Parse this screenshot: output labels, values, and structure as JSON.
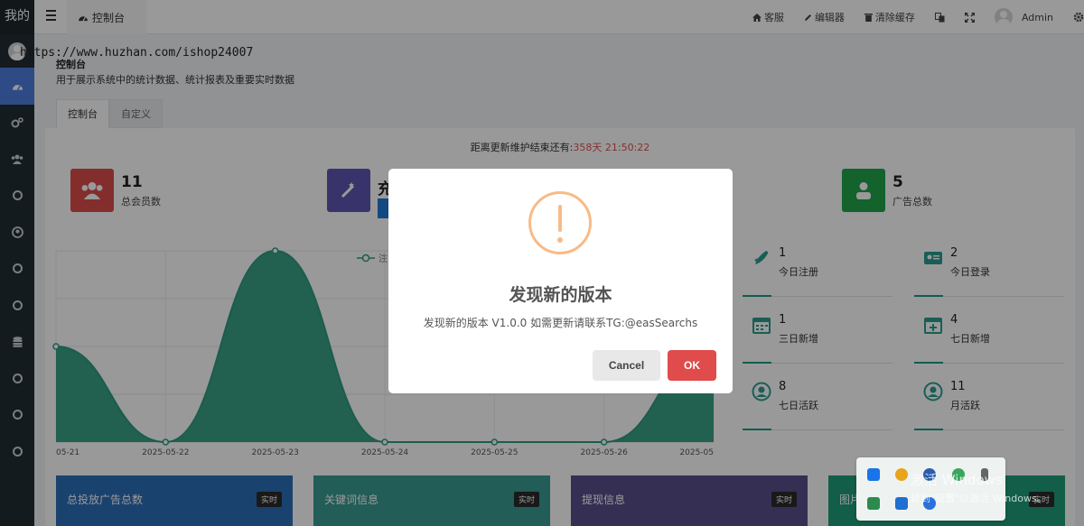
{
  "sidebar": {
    "brand": "我的",
    "items": [
      {
        "icon": "dashboard-icon",
        "active": true
      },
      {
        "icon": "cogs-icon"
      },
      {
        "icon": "users-icon"
      },
      {
        "icon": "circle-icon"
      },
      {
        "icon": "user-circle-icon"
      },
      {
        "icon": "circle-icon"
      },
      {
        "icon": "circle-icon"
      },
      {
        "icon": "database-icon"
      },
      {
        "icon": "circle-icon"
      },
      {
        "icon": "circle-icon"
      },
      {
        "icon": "circle-icon"
      }
    ]
  },
  "topbar": {
    "tab_label": "控制台",
    "kefu": "客服",
    "editor": "编辑器",
    "clear_cache": "清除缓存",
    "admin": "Admin"
  },
  "watermark_url": "https://www.huzhan.com/ishop24007",
  "page": {
    "title": "控制台",
    "description": "用于展示系统中的统计数据、统计报表及重要实时数据",
    "tabs": [
      "控制台",
      "自定义"
    ]
  },
  "maintenance": {
    "label": "距离更新维护结束还有:",
    "value": "358天 21:50:22"
  },
  "stats": [
    {
      "value": "11",
      "label": "总会员数",
      "color": "#dd4b4b"
    },
    {
      "value": "充",
      "label": "",
      "color": "#5e58b3"
    },
    {
      "value": "5",
      "label": "广告总数",
      "color": "#22a34a"
    }
  ],
  "mini_stats": [
    {
      "value": "1",
      "label": "今日注册",
      "icon": "rocket-icon"
    },
    {
      "value": "2",
      "label": "今日登录",
      "icon": "id-card-icon"
    },
    {
      "value": "1",
      "label": "三日新增",
      "icon": "calendar-icon"
    },
    {
      "value": "4",
      "label": "七日新增",
      "icon": "calendar-plus-icon"
    },
    {
      "value": "8",
      "label": "七日活跃",
      "icon": "user-circle-icon"
    },
    {
      "value": "11",
      "label": "月活跃",
      "icon": "user-circle-icon"
    }
  ],
  "chart_data": {
    "type": "area",
    "x": [
      "05-21",
      "2025-05-22",
      "2025-05-23",
      "2025-05-24",
      "2025-05-25",
      "2025-05-26",
      "2025-05"
    ],
    "series": [
      {
        "name": "注",
        "values": [
          1,
          0,
          2,
          0,
          0,
          0,
          1
        ]
      }
    ],
    "ylim": [
      0,
      2
    ],
    "grid": true,
    "color": "#2e9b80"
  },
  "cards": [
    {
      "title": "总投放广告总数",
      "badge": "实时",
      "color": "#2c6fb8"
    },
    {
      "title": "关键词信息",
      "badge": "实时",
      "color": "#3a9c93"
    },
    {
      "title": "提现信息",
      "badge": "实时",
      "color": "#5a4f8c"
    },
    {
      "title": "图片",
      "badge": "实时",
      "color": "#1f9d78"
    }
  ],
  "modal": {
    "title": "发现新的版本",
    "text": "发现新的版本 V1.0.0 如需更新请联系TG:@easSearchs",
    "cancel": "Cancel",
    "ok": "OK",
    "accent": "#f8bb86"
  },
  "activation": {
    "line1": "激活 Windows",
    "line2": "转到\"设置\"以激活 Windows。"
  }
}
